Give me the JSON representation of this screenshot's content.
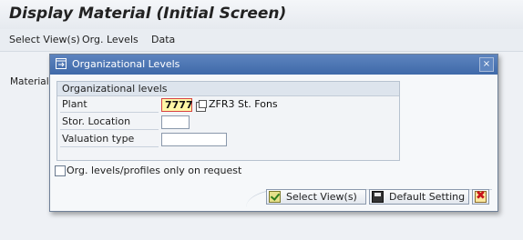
{
  "window": {
    "title": "Display Material (Initial Screen)"
  },
  "menu": {
    "items": [
      "Select View(s)",
      "Org. Levels",
      "Data"
    ]
  },
  "background": {
    "material_label": "Material"
  },
  "dialog": {
    "title": "Organizational Levels",
    "close_symbol": "×",
    "group_title": "Organizational levels",
    "fields": [
      {
        "label": "Plant",
        "value": "7777",
        "description": "ZFR3 St. Fons"
      },
      {
        "label": "Stor. Location",
        "value": ""
      },
      {
        "label": "Valuation type",
        "value": ""
      }
    ],
    "checkbox": {
      "label": "Org. levels/profiles only on request",
      "checked": false
    },
    "buttons": {
      "ok_icon": "checkmark-icon",
      "select_views": "Select View(s)",
      "default_setting": "Default Setting",
      "save_icon": "floppy-disk-icon",
      "cancel_icon": "cancel-x-icon",
      "cancel_symbol": "✖"
    }
  },
  "colors": {
    "dialog_header": "#4a72b1",
    "highlight_field_bg": "#fff7a6",
    "highlight_field_border": "#d84242",
    "cancel_red": "#c8151b"
  }
}
